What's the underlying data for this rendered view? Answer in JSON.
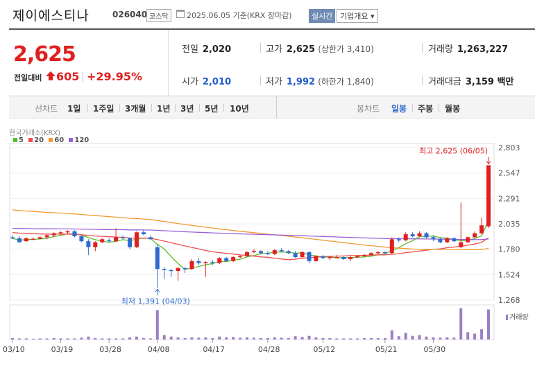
{
  "header": {
    "name": "제이에스티나",
    "code": "026040",
    "market": "코스닥",
    "date_text": "2025.06.05 기준(KRX 장마감)",
    "realtime_label": "실시간",
    "company_label": "기업개요 ▾"
  },
  "summary": {
    "price": "2,625",
    "change_label": "전일대비",
    "change_value": "605",
    "change_pct": "+29.95%",
    "prev_close_label": "전일",
    "prev_close": "2,020",
    "open_label": "시가",
    "open": "2,010",
    "high_label": "고가",
    "high": "2,625",
    "upper_limit": "(상한가 3,410)",
    "low_label": "저가",
    "low": "1,992",
    "lower_limit": "(하한가 1,840)",
    "volume_label": "거래량",
    "volume": "1,263,227",
    "amount_label": "거래대금",
    "amount": "3,159 백만"
  },
  "periods": {
    "line_label": "선차트",
    "line_items": [
      "1일",
      "1주일",
      "3개월",
      "1년",
      "3년",
      "5년",
      "10년"
    ],
    "candle_label": "봉차트",
    "candle_items": [
      "일봉",
      "주봉",
      "월봉"
    ],
    "selected_candle": "일봉"
  },
  "colors": {
    "up": "#e02020",
    "down": "#2e6bd1",
    "ma5": "#5bbd2b",
    "ma20": "#ee4b4b",
    "ma60": "#f39a32",
    "ma120": "#9a5fd6",
    "volume": "#9a7fc6"
  },
  "chart_data": {
    "type": "candlestick",
    "source_label": "한국거래소(KRX)",
    "ma_legend": [
      "5",
      "20",
      "60",
      "120"
    ],
    "y_ticks": [
      "2,803",
      "2,547",
      "2,291",
      "2,035",
      "1,780",
      "1,524",
      "1,268"
    ],
    "ylim": [
      1268,
      2803
    ],
    "x_ticks": [
      "03/10",
      "03/19",
      "03/28",
      "04/08",
      "04/17",
      "04/28",
      "05/12",
      "05/21",
      "05/30"
    ],
    "max_annotation": "최고 2,625 (06/05)",
    "min_annotation": "최저 1,391 (04/03)",
    "volume_label": "거래량",
    "candles": [
      [
        1900,
        1920,
        1880,
        1890
      ],
      [
        1890,
        1910,
        1840,
        1850
      ],
      [
        1860,
        1900,
        1850,
        1890
      ],
      [
        1880,
        1900,
        1870,
        1885
      ],
      [
        1885,
        1910,
        1880,
        1900
      ],
      [
        1900,
        1930,
        1880,
        1920
      ],
      [
        1920,
        1950,
        1900,
        1940
      ],
      [
        1940,
        1960,
        1920,
        1950
      ],
      [
        1950,
        1970,
        1930,
        1960
      ],
      [
        1960,
        1970,
        1900,
        1910
      ],
      [
        1910,
        1920,
        1850,
        1860
      ],
      [
        1860,
        1880,
        1720,
        1800
      ],
      [
        1800,
        1860,
        1760,
        1850
      ],
      [
        1850,
        1890,
        1840,
        1880
      ],
      [
        1870,
        1890,
        1850,
        1860
      ],
      [
        1860,
        1990,
        1850,
        1900
      ],
      [
        1900,
        1920,
        1880,
        1890
      ],
      [
        1890,
        1900,
        1780,
        1800
      ],
      [
        1800,
        1960,
        1790,
        1950
      ],
      [
        1950,
        1970,
        1920,
        1930
      ],
      [
        1900,
        1920,
        1880,
        1880
      ],
      [
        1800,
        1830,
        1391,
        1580
      ],
      [
        1580,
        1600,
        1480,
        1570
      ],
      [
        1570,
        1580,
        1500,
        1560
      ],
      [
        1560,
        1600,
        1460,
        1590
      ],
      [
        1590,
        1600,
        1540,
        1580
      ],
      [
        1580,
        1680,
        1570,
        1660
      ],
      [
        1660,
        1690,
        1620,
        1640
      ],
      [
        1640,
        1660,
        1500,
        1650
      ],
      [
        1650,
        1670,
        1620,
        1640
      ],
      [
        1640,
        1700,
        1630,
        1690
      ],
      [
        1690,
        1700,
        1650,
        1660
      ],
      [
        1660,
        1710,
        1650,
        1700
      ],
      [
        1700,
        1720,
        1690,
        1710
      ],
      [
        1710,
        1760,
        1700,
        1750
      ],
      [
        1750,
        1780,
        1740,
        1760
      ],
      [
        1760,
        1770,
        1730,
        1740
      ],
      [
        1740,
        1760,
        1720,
        1730
      ],
      [
        1730,
        1780,
        1720,
        1770
      ],
      [
        1770,
        1790,
        1750,
        1760
      ],
      [
        1760,
        1770,
        1730,
        1740
      ],
      [
        1740,
        1760,
        1690,
        1700
      ],
      [
        1700,
        1760,
        1690,
        1750
      ],
      [
        1750,
        1760,
        1640,
        1660
      ],
      [
        1660,
        1720,
        1650,
        1710
      ],
      [
        1710,
        1720,
        1680,
        1690
      ],
      [
        1690,
        1710,
        1670,
        1700
      ],
      [
        1700,
        1720,
        1690,
        1700
      ],
      [
        1700,
        1710,
        1670,
        1680
      ],
      [
        1680,
        1710,
        1660,
        1700
      ],
      [
        1700,
        1720,
        1690,
        1710
      ],
      [
        1710,
        1730,
        1700,
        1720
      ],
      [
        1720,
        1750,
        1710,
        1740
      ],
      [
        1740,
        1760,
        1730,
        1750
      ],
      [
        1750,
        1760,
        1730,
        1740
      ],
      [
        1740,
        1900,
        1730,
        1880
      ],
      [
        1880,
        1900,
        1850,
        1870
      ],
      [
        1870,
        1950,
        1860,
        1930
      ],
      [
        1930,
        1950,
        1900,
        1910
      ],
      [
        1910,
        1960,
        1900,
        1940
      ],
      [
        1940,
        1950,
        1890,
        1900
      ],
      [
        1900,
        1920,
        1860,
        1880
      ],
      [
        1880,
        1900,
        1840,
        1850
      ],
      [
        1850,
        1900,
        1840,
        1890
      ],
      [
        1890,
        1900,
        1850,
        1860
      ],
      [
        1800,
        2250,
        1790,
        1850
      ],
      [
        1850,
        1910,
        1840,
        1900
      ],
      [
        1900,
        1960,
        1890,
        1940
      ],
      [
        1940,
        2100,
        1930,
        2020
      ],
      [
        2010,
        2625,
        1992,
        2625
      ]
    ],
    "volumes": [
      4,
      3,
      3,
      2,
      3,
      3,
      4,
      3,
      3,
      3,
      5,
      8,
      4,
      3,
      3,
      3,
      3,
      6,
      8,
      4,
      3,
      80,
      12,
      8,
      6,
      4,
      6,
      5,
      6,
      4,
      8,
      6,
      7,
      5,
      6,
      5,
      4,
      4,
      6,
      5,
      4,
      9,
      7,
      10,
      6,
      4,
      4,
      3,
      3,
      3,
      3,
      4,
      4,
      4,
      4,
      25,
      9,
      18,
      10,
      12,
      8,
      6,
      5,
      6,
      5,
      85,
      20,
      16,
      28,
      82
    ]
  }
}
